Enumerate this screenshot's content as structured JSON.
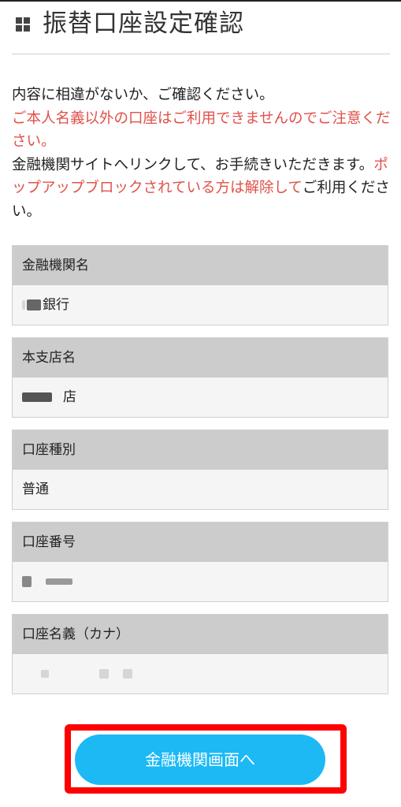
{
  "header": {
    "title": "振替口座設定確認",
    "icon": "grid-icon"
  },
  "notice": {
    "line1": "内容に相違がないか、ご確認ください。",
    "warning": "ご本人名義以外の口座はご利用できませんのでご注意ください。",
    "line2": "金融機関サイトへリンクして、お手続きいただきます。",
    "popup_warning": "ポップアップブロックされている方は解除して",
    "line3": "ご利用ください。"
  },
  "fields": [
    {
      "label": "金融機関名",
      "value": "銀行"
    },
    {
      "label": "本支店名",
      "value": "店"
    },
    {
      "label": "口座種別",
      "value": "普通"
    },
    {
      "label": "口座番号",
      "value": ""
    },
    {
      "label": "口座名義（カナ）",
      "value": ""
    }
  ],
  "cta": {
    "label": "金融機関画面へ"
  },
  "colors": {
    "accent": "#1cb9f5",
    "warning": "#e0504a",
    "highlight": "#ff0000"
  }
}
